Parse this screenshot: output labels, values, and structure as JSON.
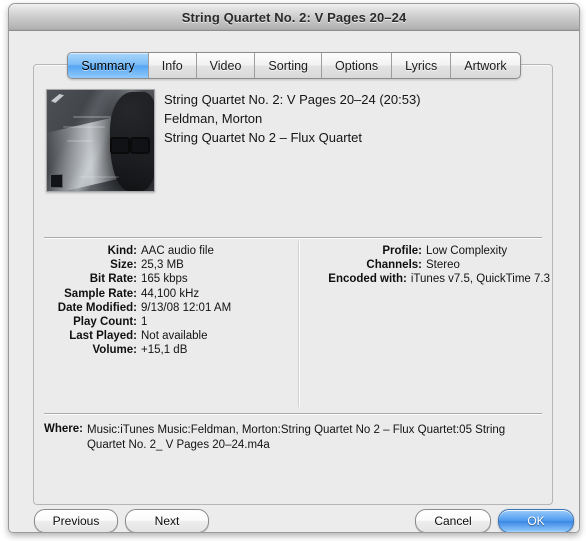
{
  "window": {
    "title": "String Quartet No. 2: V Pages 20–24"
  },
  "tabs": [
    {
      "label": "Summary",
      "active": true
    },
    {
      "label": "Info",
      "active": false
    },
    {
      "label": "Video",
      "active": false
    },
    {
      "label": "Sorting",
      "active": false
    },
    {
      "label": "Options",
      "active": false
    },
    {
      "label": "Lyrics",
      "active": false
    },
    {
      "label": "Artwork",
      "active": false
    }
  ],
  "track": {
    "title_line": "String Quartet No. 2: V Pages 20–24 (20:53)",
    "artist_line": "Feldman, Morton",
    "album_line": "String Quartet No 2 – Flux Quartet",
    "artwork_alt": "album-artwork"
  },
  "details_left": [
    {
      "label": "Kind:",
      "value": "AAC audio file"
    },
    {
      "label": "Size:",
      "value": "25,3 MB"
    },
    {
      "label": "Bit Rate:",
      "value": "165 kbps"
    },
    {
      "label": "Sample Rate:",
      "value": "44,100 kHz"
    },
    {
      "label": "Date Modified:",
      "value": "9/13/08 12:01 AM"
    },
    {
      "label": "Play Count:",
      "value": "1"
    },
    {
      "label": "Last Played:",
      "value": "Not available"
    },
    {
      "label": "Volume:",
      "value": "+15,1 dB"
    }
  ],
  "details_right": [
    {
      "label": "Profile:",
      "value": "Low Complexity"
    },
    {
      "label": "Channels:",
      "value": "Stereo"
    },
    {
      "label": "Encoded with:",
      "value": "iTunes v7.5, QuickTime 7.3"
    }
  ],
  "where": {
    "label": "Where:",
    "value": "Music:iTunes Music:Feldman, Morton:String Quartet No 2 – Flux Quartet:05 String Quartet No. 2_ V Pages 20–24.m4a"
  },
  "buttons": {
    "previous": "Previous",
    "next": "Next",
    "cancel": "Cancel",
    "ok": "OK"
  },
  "colors": {
    "active_tab_blue": "#55a6f3",
    "ok_button_blue": "#3a87e4",
    "window_background": "#ececec",
    "panel_background": "#ebebeb"
  }
}
